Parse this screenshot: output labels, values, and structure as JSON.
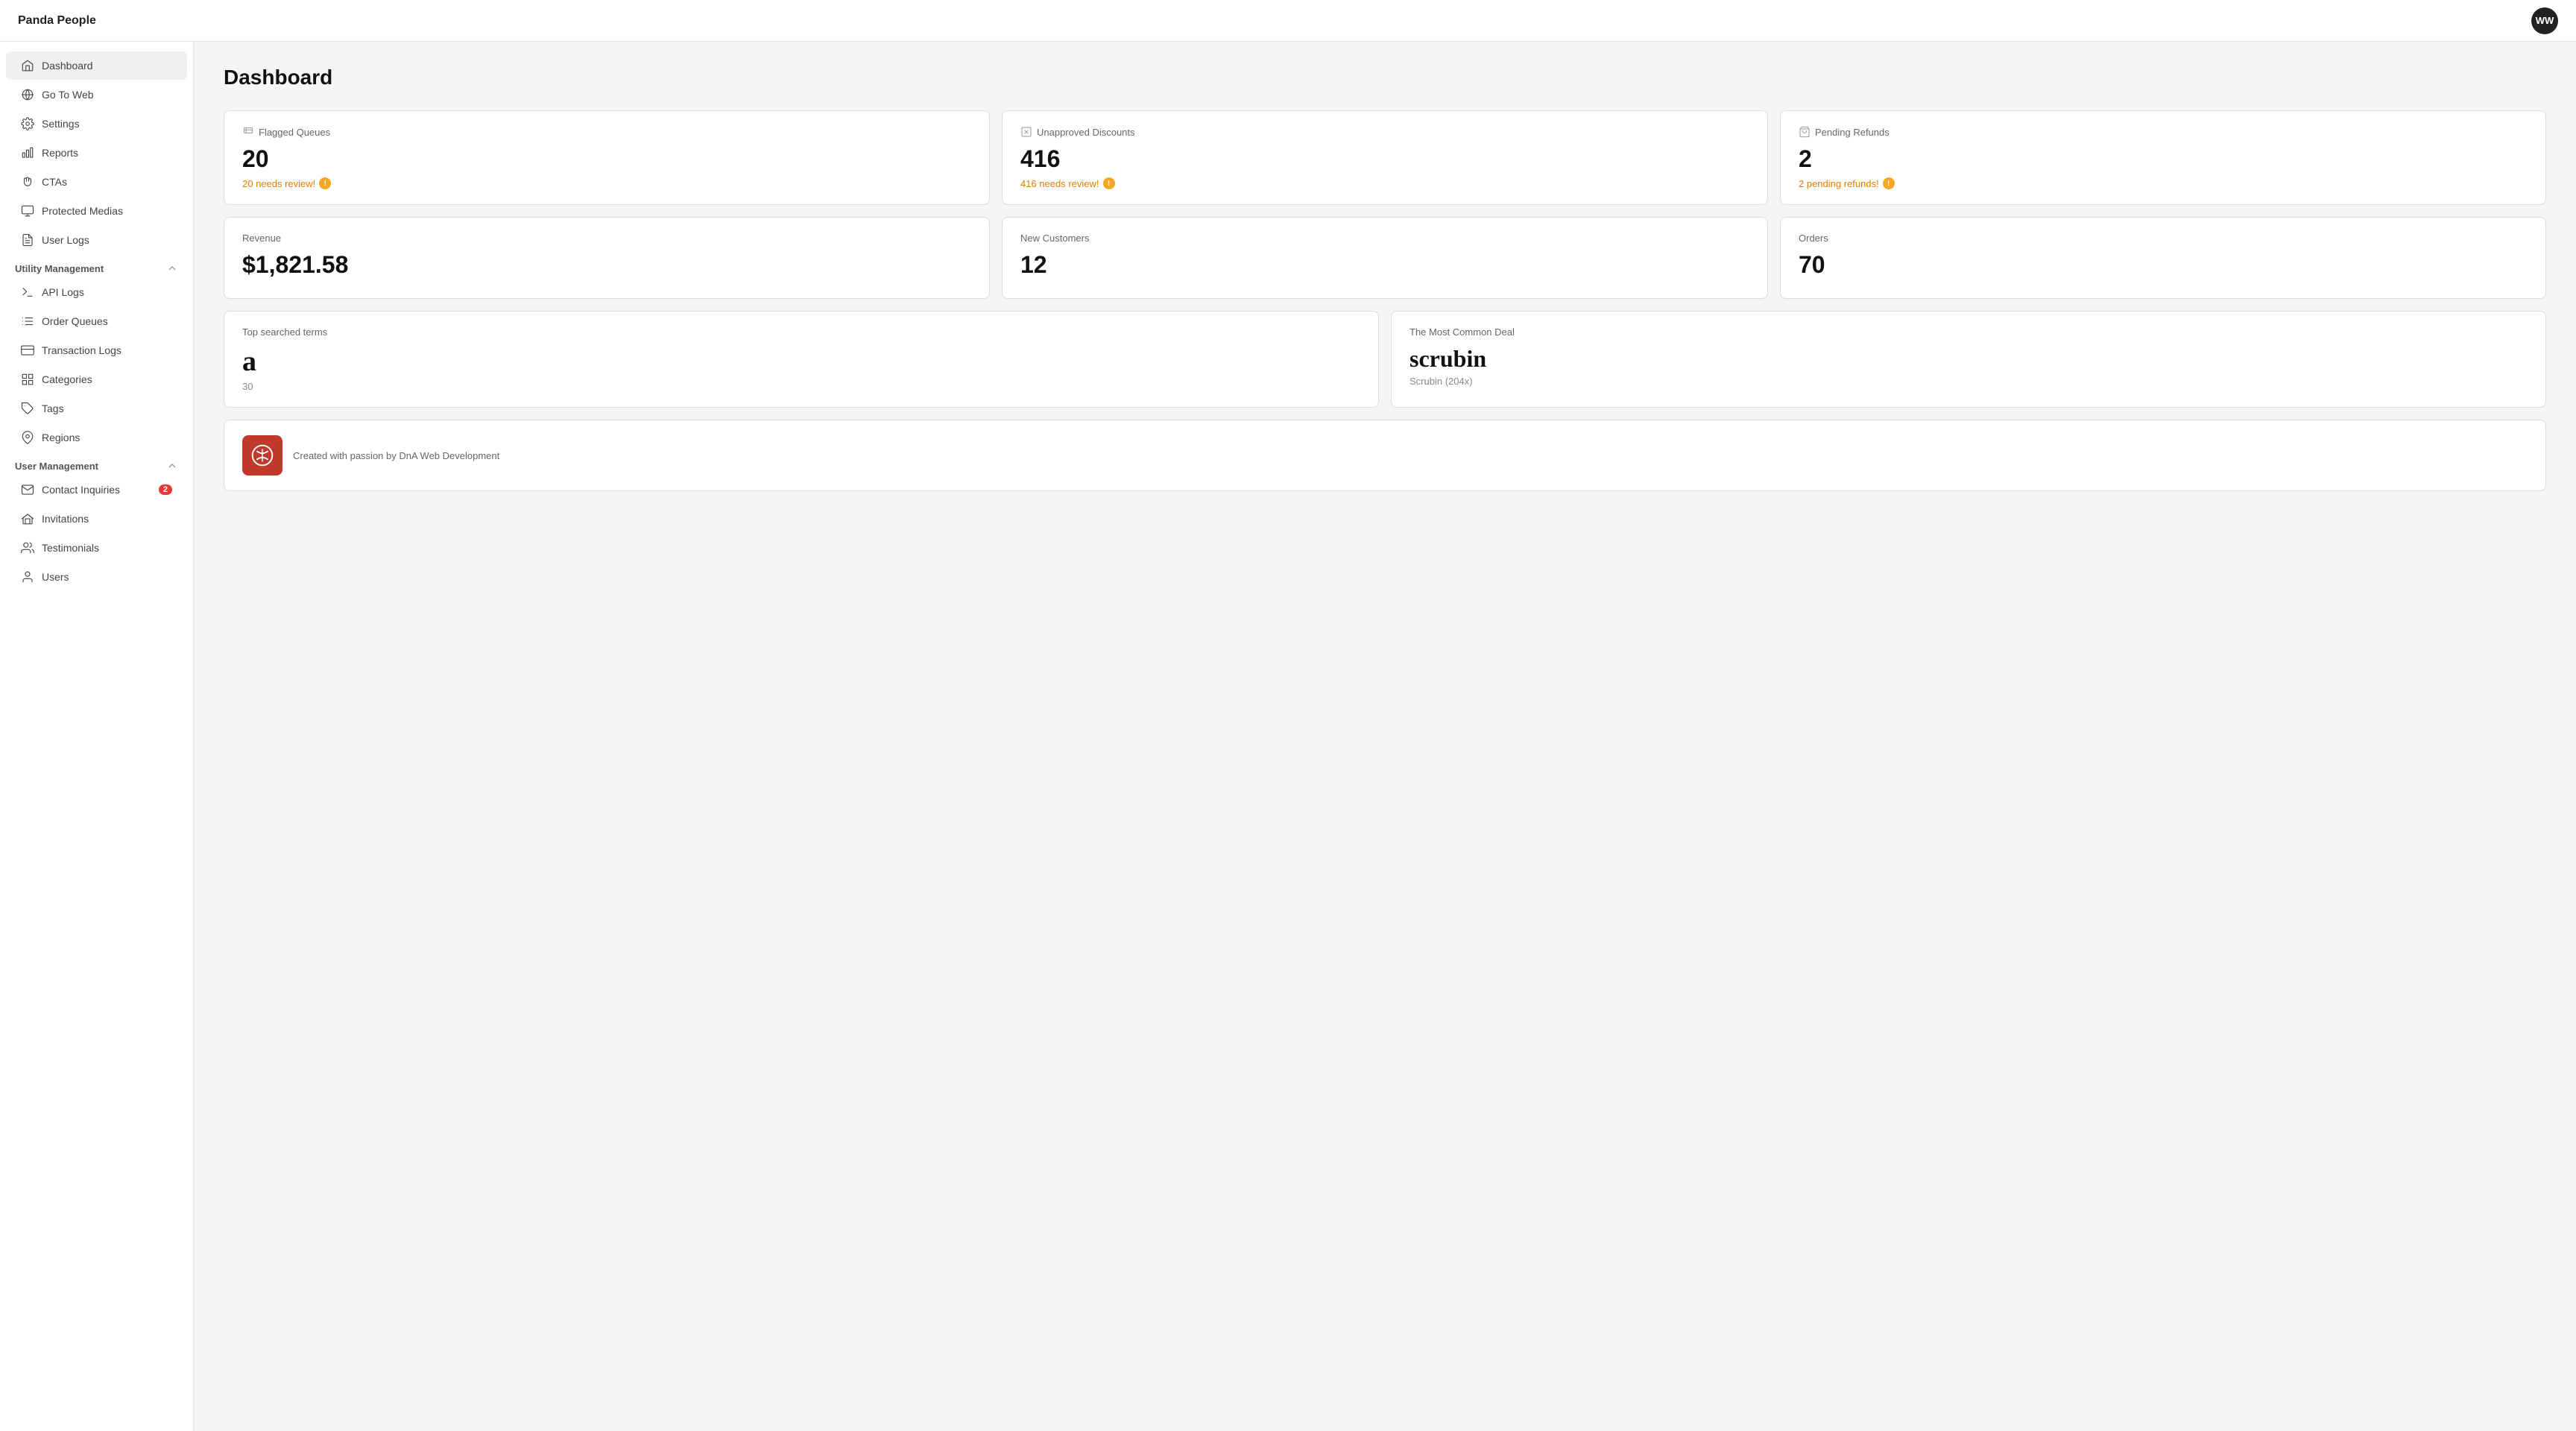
{
  "app": {
    "title": "Panda People",
    "avatar_initials": "WW"
  },
  "sidebar": {
    "main_items": [
      {
        "id": "dashboard",
        "label": "Dashboard",
        "icon": "home",
        "active": true
      },
      {
        "id": "go-to-web",
        "label": "Go To Web",
        "icon": "globe"
      },
      {
        "id": "settings",
        "label": "Settings",
        "icon": "settings"
      },
      {
        "id": "reports",
        "label": "Reports",
        "icon": "bar-chart"
      },
      {
        "id": "ctas",
        "label": "CTAs",
        "icon": "hand"
      },
      {
        "id": "protected-medias",
        "label": "Protected Medias",
        "icon": "monitor"
      },
      {
        "id": "user-logs",
        "label": "User Logs",
        "icon": "file-text"
      }
    ],
    "utility_section": {
      "label": "Utility Management",
      "items": [
        {
          "id": "api-logs",
          "label": "API Logs",
          "icon": "terminal"
        },
        {
          "id": "order-queues",
          "label": "Order Queues",
          "icon": "list"
        },
        {
          "id": "transaction-logs",
          "label": "Transaction Logs",
          "icon": "credit-card"
        },
        {
          "id": "categories",
          "label": "Categories",
          "icon": "grid"
        },
        {
          "id": "tags",
          "label": "Tags",
          "icon": "tag"
        },
        {
          "id": "regions",
          "label": "Regions",
          "icon": "map-pin"
        }
      ]
    },
    "user_section": {
      "label": "User Management",
      "items": [
        {
          "id": "contact-inquiries",
          "label": "Contact Inquiries",
          "icon": "mail",
          "badge": "2"
        },
        {
          "id": "invitations",
          "label": "Invitations",
          "icon": "mail-open"
        },
        {
          "id": "testimonials",
          "label": "Testimonials",
          "icon": "users"
        },
        {
          "id": "users",
          "label": "Users",
          "icon": "user"
        }
      ]
    }
  },
  "dashboard": {
    "title": "Dashboard",
    "cards": {
      "flagged_queues": {
        "label": "Flagged Queues",
        "value": "20",
        "alert": "20 needs review!"
      },
      "unapproved_discounts": {
        "label": "Unapproved Discounts",
        "value": "416",
        "alert": "416 needs review!"
      },
      "pending_refunds": {
        "label": "Pending Refunds",
        "value": "2",
        "alert": "2 pending refunds!"
      },
      "revenue": {
        "label": "Revenue",
        "value": "$1,821.58"
      },
      "new_customers": {
        "label": "New Customers",
        "value": "12"
      },
      "orders": {
        "label": "Orders",
        "value": "70"
      },
      "top_searched": {
        "label": "Top searched terms",
        "term": "a",
        "count": "30"
      },
      "most_common_deal": {
        "label": "The Most Common Deal",
        "term": "scrubin",
        "sub": "Scrubin (204x)"
      }
    },
    "footer": {
      "text": "Created with passion by DnA Web Development"
    }
  }
}
